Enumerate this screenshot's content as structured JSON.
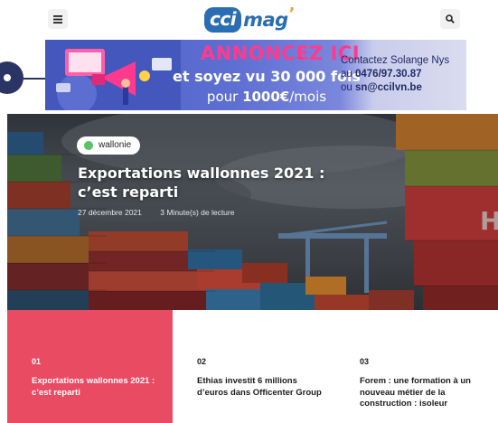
{
  "header": {
    "logo_main": "cci",
    "logo_suffix": "mag",
    "menu_icon": "hamburger-icon",
    "search_icon": "search-icon"
  },
  "banner": {
    "headline": "ANNONCEZ ICI",
    "line2": "et soyez vu 30 000 fois",
    "line3_prefix": "pour ",
    "line3_price": "1000€",
    "line3_suffix": "/mois",
    "contact_line1": "Contactez Solange Nys",
    "contact_phone_prefix": "au ",
    "contact_phone": "0476/97.30.87",
    "contact_email_prefix": "ou ",
    "contact_email": "sn@ccilvn.be"
  },
  "hero": {
    "category": "wallonie",
    "title": "Exportations wallonnes 2021 : c’est reparti",
    "date": "27 décembre 2021",
    "reading_time": "3 Minute(s) de lecture"
  },
  "articles": [
    {
      "number": "01",
      "title": "Exportations wallonnes 2021 : c’est reparti"
    },
    {
      "number": "02",
      "title": "Ethias investit 6 millions d’euros dans Officenter Group"
    },
    {
      "number": "03",
      "title": "Forem : une formation à un nouveau métier de la construction : isoleur"
    }
  ],
  "colors": {
    "accent": "#e94b63",
    "brand_blue": "#2b6db3",
    "banner_pink": "#ff3a8e",
    "category_dot": "#59c26a"
  }
}
